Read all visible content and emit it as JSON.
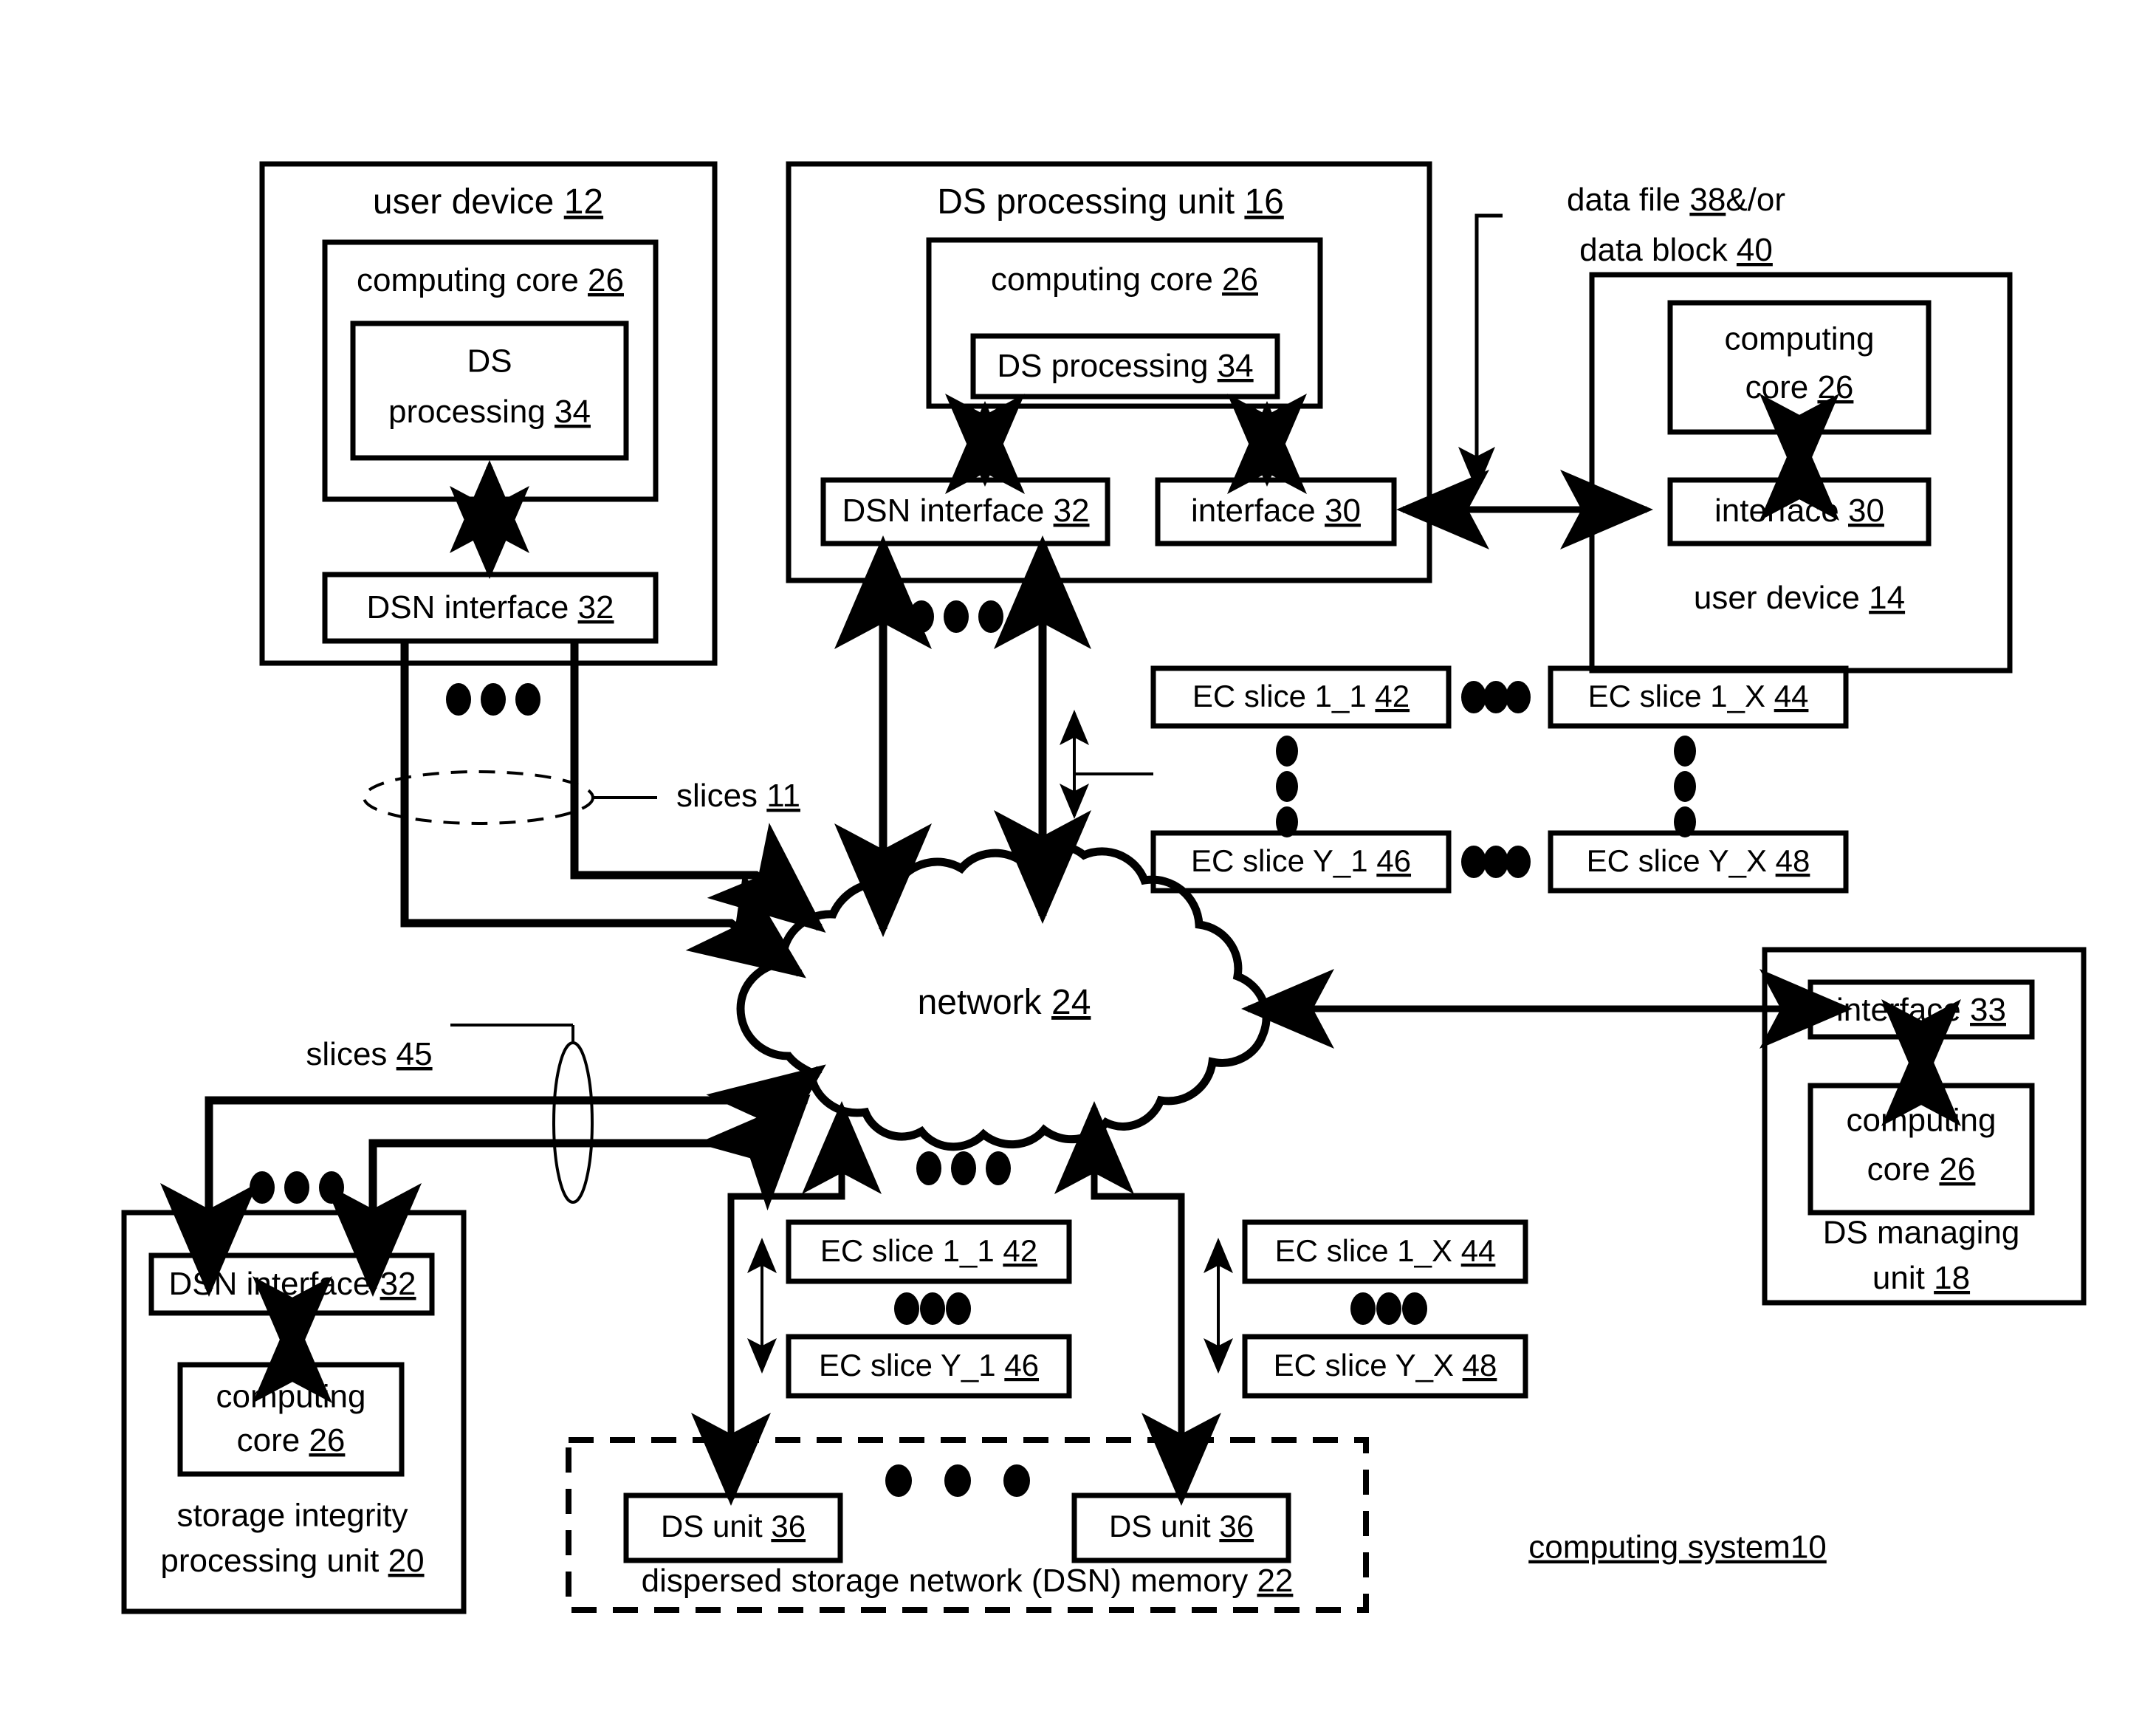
{
  "figure": {
    "title": "computing system10",
    "title_underlined": true
  },
  "user_device_12": {
    "label": "user device",
    "ref": "12",
    "computing_core": {
      "label": "computing core",
      "ref": "26"
    },
    "ds_processing": {
      "label_line1": "DS",
      "label_line2": "processing",
      "ref": "34"
    },
    "dsn_interface": {
      "label": "DSN interface",
      "ref": "32"
    }
  },
  "ds_processing_unit_16": {
    "label": "DS processing unit",
    "ref": "16",
    "computing_core": {
      "label": "computing core",
      "ref": "26"
    },
    "ds_processing": {
      "label": "DS processing",
      "ref": "34"
    },
    "dsn_interface": {
      "label": "DSN interface",
      "ref": "32"
    },
    "interface": {
      "label": "interface",
      "ref": "30"
    }
  },
  "user_device_14": {
    "label": "user device",
    "ref": "14",
    "computing_core": {
      "label_line1": "computing",
      "label_line2": "core",
      "ref": "26"
    },
    "interface": {
      "label": "interface",
      "ref": "30"
    }
  },
  "data_label": {
    "line1_text": "data file",
    "line1_ref": "38",
    "line1_suffix": "&/or",
    "line2_text": "data block",
    "line2_ref": "40"
  },
  "network": {
    "label": "network",
    "ref": "24"
  },
  "slices_11": {
    "label": "slices",
    "ref": "11"
  },
  "slices_45": {
    "label": "slices",
    "ref": "45"
  },
  "ec_slices_upper": [
    {
      "label": "EC slice 1_1",
      "ref": "42"
    },
    {
      "label": "EC slice 1_X",
      "ref": "44"
    },
    {
      "label": "EC slice Y_1",
      "ref": "46"
    },
    {
      "label": "EC slice Y_X",
      "ref": "48"
    }
  ],
  "ec_slices_lower": [
    {
      "label": "EC slice 1_1",
      "ref": "42"
    },
    {
      "label": "EC slice 1_X",
      "ref": "44"
    },
    {
      "label": "EC slice Y_1",
      "ref": "46"
    },
    {
      "label": "EC slice Y_X",
      "ref": "48"
    }
  ],
  "ds_managing_unit_18": {
    "interface": {
      "label": "interface",
      "ref": "33"
    },
    "computing_core": {
      "label_line1": "computing",
      "label_line2": "core",
      "ref": "26"
    },
    "label_line1": "DS managing",
    "label_line2": "unit",
    "ref": "18"
  },
  "storage_integrity_unit_20": {
    "dsn_interface": {
      "label": "DSN interface",
      "ref": "32"
    },
    "computing_core": {
      "label_line1": "computing",
      "label_line2": "core",
      "ref": "26"
    },
    "label_line1": "storage integrity",
    "label_line2": "processing unit",
    "ref": "20"
  },
  "dsn_memory_22": {
    "label": "dispersed storage network (DSN) memory",
    "ref": "22",
    "ds_units": [
      {
        "label": "DS unit",
        "ref": "36"
      },
      {
        "label": "DS unit",
        "ref": "36"
      }
    ]
  },
  "colors": {
    "stroke": "#000000",
    "background": "#ffffff"
  }
}
